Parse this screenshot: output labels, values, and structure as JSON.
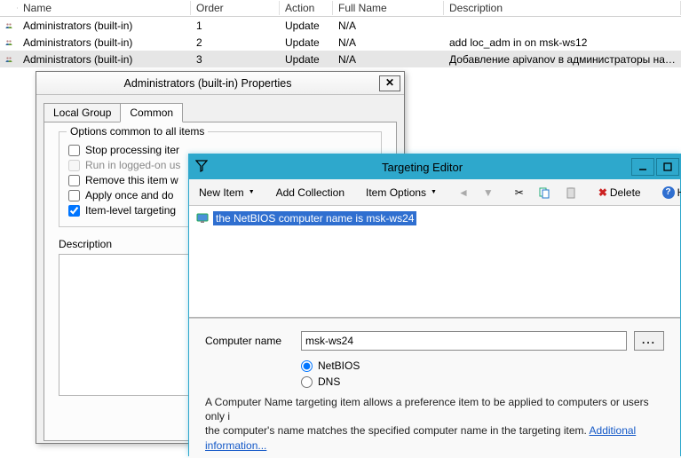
{
  "list": {
    "headers": {
      "name": "Name",
      "order": "Order",
      "action": "Action",
      "full": "Full Name",
      "desc": "Description"
    },
    "rows": [
      {
        "name": "Administrators (built-in)",
        "order": "1",
        "action": "Update",
        "full": "N/A",
        "desc": ""
      },
      {
        "name": "Administrators (built-in)",
        "order": "2",
        "action": "Update",
        "full": "N/A",
        "desc": "add loc_adm           in on msk-ws12"
      },
      {
        "name": "Administrators (built-in)",
        "order": "3",
        "action": "Update",
        "full": "N/A",
        "desc": "Добавление apivanov в администраторы на комп…"
      }
    ]
  },
  "props": {
    "title": "Administrators (built-in) Properties",
    "tabs": {
      "local": "Local Group",
      "common": "Common"
    },
    "group_title": "Options common to all items",
    "opts": {
      "stop": "Stop processing iter",
      "run": "Run in logged-on us",
      "remove": "Remove this item w",
      "apply": "Apply once and do",
      "target": "Item-level targeting"
    },
    "desc_label": "Description"
  },
  "te": {
    "title": "Targeting Editor",
    "toolbar": {
      "newitem": "New Item",
      "addcoll": "Add Collection",
      "itemopt": "Item Options",
      "delete": "Delete",
      "help": "Help"
    },
    "tree_item": "the NetBIOS computer name is msk-ws24",
    "form": {
      "label": "Computer name",
      "value": "msk-ws24",
      "r_netbios": "NetBIOS",
      "r_dns": "DNS"
    },
    "desc1": "A Computer Name targeting item allows a preference item to be applied to computers or users only i",
    "desc2": "the computer's name matches the specified computer name in the targeting item.  ",
    "link": "Additional information..."
  }
}
